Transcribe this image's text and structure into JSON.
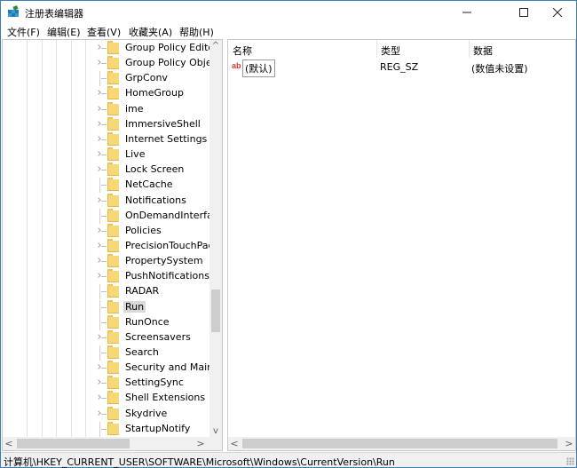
{
  "window": {
    "title": "注册表编辑器",
    "controls": {
      "minimize": "—",
      "maximize": "☐",
      "close": "✕"
    }
  },
  "menu": [
    {
      "label": "文件(F)"
    },
    {
      "label": "编辑(E)"
    },
    {
      "label": "查看(V)"
    },
    {
      "label": "收藏夹(A)"
    },
    {
      "label": "帮助(H)"
    }
  ],
  "tree": {
    "selected": "Run",
    "items": [
      {
        "label": "Group Policy Editor",
        "expandable": true
      },
      {
        "label": "Group Policy Objec",
        "expandable": true
      },
      {
        "label": "GrpConv",
        "expandable": false
      },
      {
        "label": "HomeGroup",
        "expandable": true
      },
      {
        "label": "ime",
        "expandable": true
      },
      {
        "label": "ImmersiveShell",
        "expandable": true
      },
      {
        "label": "Internet Settings",
        "expandable": true
      },
      {
        "label": "Live",
        "expandable": true
      },
      {
        "label": "Lock Screen",
        "expandable": true
      },
      {
        "label": "NetCache",
        "expandable": false
      },
      {
        "label": "Notifications",
        "expandable": true
      },
      {
        "label": "OnDemandInterface",
        "expandable": false
      },
      {
        "label": "Policies",
        "expandable": true
      },
      {
        "label": "PrecisionTouchPad",
        "expandable": true
      },
      {
        "label": "PropertySystem",
        "expandable": true
      },
      {
        "label": "PushNotifications",
        "expandable": true
      },
      {
        "label": "RADAR",
        "expandable": false
      },
      {
        "label": "Run",
        "expandable": false
      },
      {
        "label": "RunOnce",
        "expandable": false
      },
      {
        "label": "Screensavers",
        "expandable": true
      },
      {
        "label": "Search",
        "expandable": false
      },
      {
        "label": "Security and Mainte",
        "expandable": true
      },
      {
        "label": "SettingSync",
        "expandable": true
      },
      {
        "label": "Shell Extensions",
        "expandable": true
      },
      {
        "label": "Skydrive",
        "expandable": true
      },
      {
        "label": "StartupNotify",
        "expandable": false
      }
    ]
  },
  "values": {
    "columns": {
      "name": "名称",
      "type": "类型",
      "data": "数据"
    },
    "rows": [
      {
        "icon": "ab",
        "name": "(默认)",
        "type": "REG_SZ",
        "data": "(数值未设置)"
      }
    ]
  },
  "status": {
    "path": "计算机\\HKEY_CURRENT_USER\\SOFTWARE\\Microsoft\\Windows\\CurrentVersion\\Run"
  },
  "scroll": {
    "arrows": {
      "up": "^",
      "down": "v",
      "left": "<",
      "right": ">"
    }
  }
}
